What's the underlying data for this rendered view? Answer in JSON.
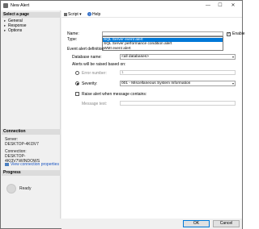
{
  "window": {
    "title": "New Alert",
    "minimize": "—",
    "maximize": "☐",
    "close": "✕"
  },
  "left": {
    "select_page_header": "Select a page",
    "pages": [
      "General",
      "Response",
      "Options"
    ],
    "connection_header": "Connection",
    "server_label": "Server:",
    "server_value": "DESKTOP-4KI3V7",
    "connection_label": "Connection:",
    "connection_value": "DESKTOP-4KI3V7\\WINDOWS",
    "view_connection_link": "View connection properties",
    "progress_header": "Progress",
    "progress_status": "Ready"
  },
  "toolbar": {
    "script_label": "Script",
    "help_label": "Help"
  },
  "form": {
    "name_label": "Name:",
    "name_value": "",
    "enable_label": "Enable",
    "enable_checked": true,
    "type_label": "Type:",
    "type_options": [
      "SQL Server event alert",
      "SQL Server performance condition alert",
      "WMI event alert"
    ],
    "type_selected_index": 0,
    "event_alert_definition_label": "Event alert definition",
    "database_name_label": "Database name:",
    "database_name_value": "<all databases>",
    "raised_based_on_label": "Alerts will be raised based on:",
    "error_number_label": "Error number:",
    "error_number_value": "1",
    "severity_label": "Severity:",
    "severity_value": "001 - Miscellaneous System Information",
    "severity_selected": true,
    "raise_alert_label": "Raise alert when message contains:",
    "raise_alert_checked": false,
    "message_text_label": "Message text:",
    "message_text_value": ""
  },
  "buttons": {
    "ok": "OK",
    "cancel": "Cancel"
  },
  "colors": {
    "selection": "#0078d7",
    "link": "#1a55c2"
  }
}
